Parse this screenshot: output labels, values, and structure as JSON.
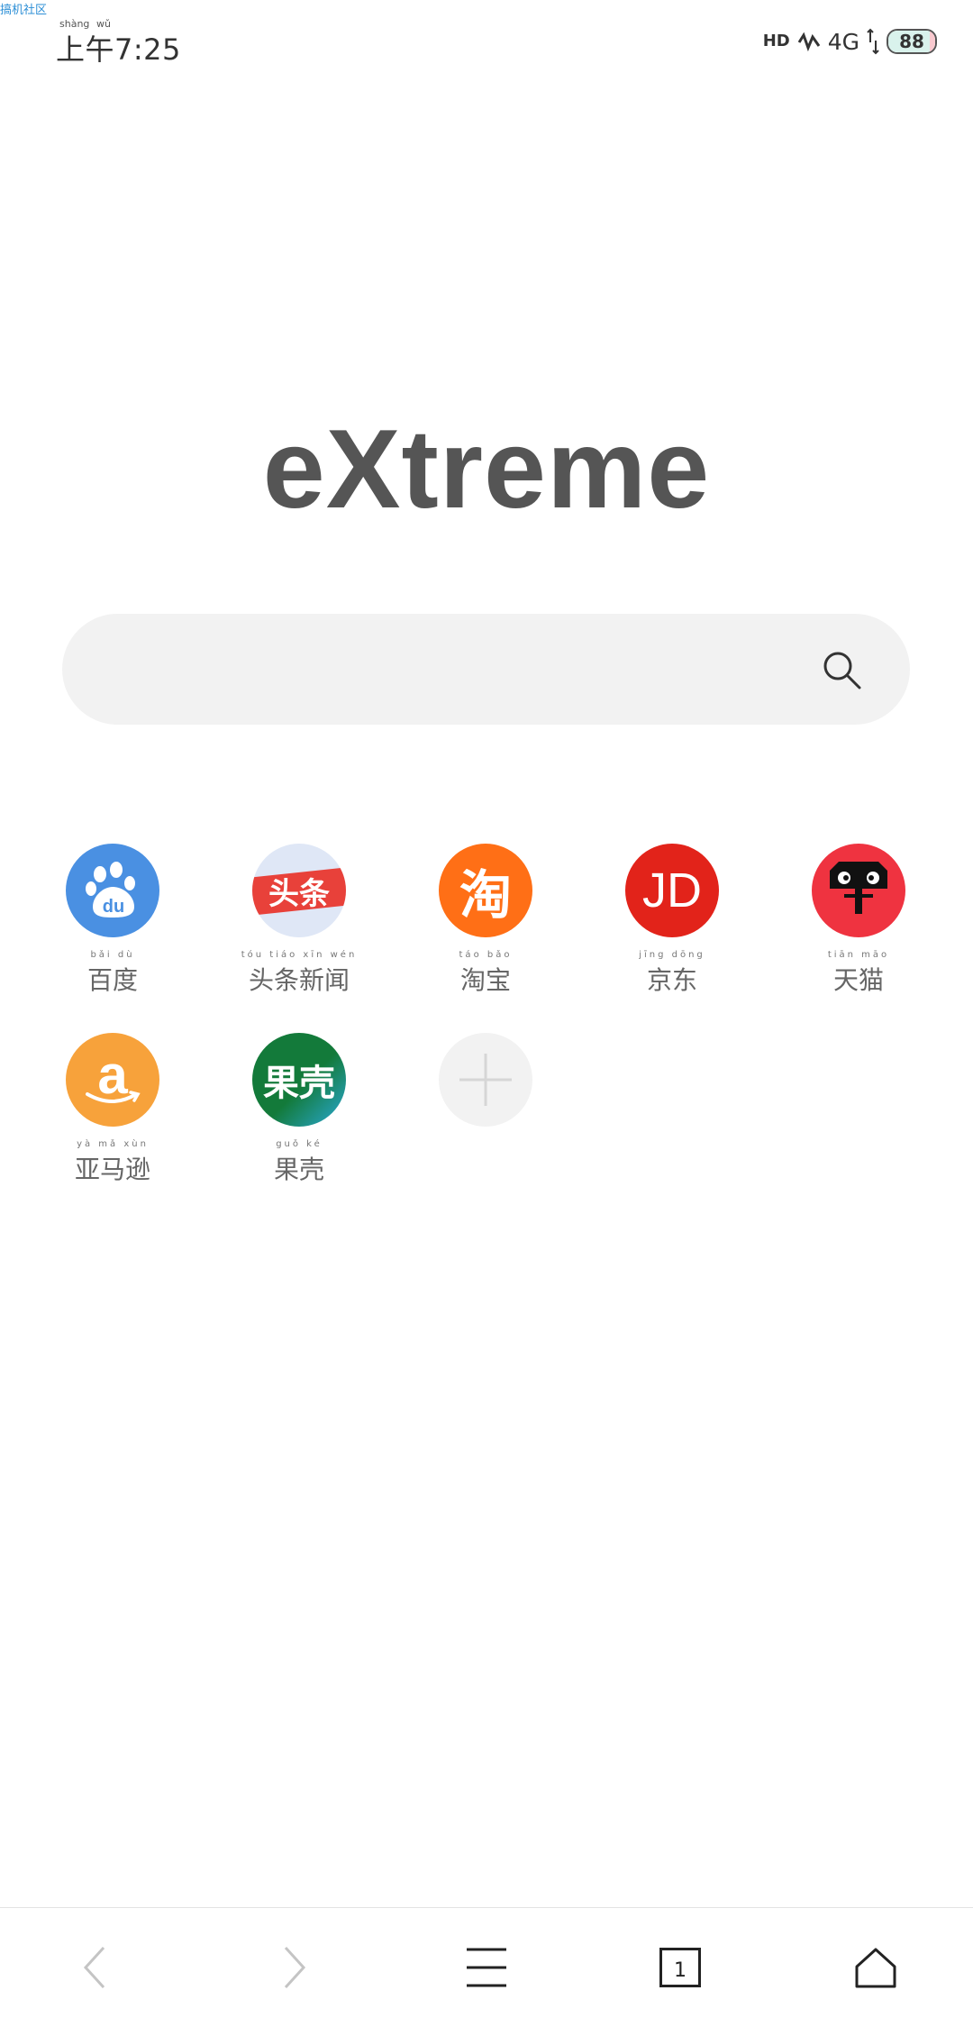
{
  "watermark": "搞机社区",
  "status_bar": {
    "time": "7:25",
    "time_prefix": "上午",
    "pinyin": [
      "shàng",
      "wǔ"
    ],
    "hd_label": "HD",
    "network": "4G",
    "battery": "88"
  },
  "logo_text": "eXtreme",
  "search": {
    "placeholder": "",
    "icon": "search-icon"
  },
  "shortcuts": [
    {
      "label": "百度",
      "pinyin": "bǎi dù",
      "color": "#4a90e2",
      "icon": "baidu-paw-icon"
    },
    {
      "label": "头条新闻",
      "pinyin": "tóu tiáo xīn wén",
      "color": "#e8413a",
      "icon": "toutiao-icon",
      "icon_text": "头条"
    },
    {
      "label": "淘宝",
      "pinyin": "táo bǎo",
      "color": "#ff6f16",
      "icon": "taobao-icon",
      "icon_text": "淘"
    },
    {
      "label": "京东",
      "pinyin": "jīng dōng",
      "color": "#e2231a",
      "icon": "jd-icon",
      "icon_text": "JD"
    },
    {
      "label": "天猫",
      "pinyin": "tiān māo",
      "color": "#ef3340",
      "icon": "tmall-cat-icon"
    },
    {
      "label": "亚马逊",
      "pinyin": "yà mǎ xùn",
      "color": "#f7a23b",
      "icon": "amazon-icon",
      "icon_text": "a"
    },
    {
      "label": "果壳",
      "pinyin": "guǒ ké",
      "color": "#137a3a",
      "icon": "guokr-icon",
      "icon_text": "果壳"
    }
  ],
  "add_shortcut": {
    "icon": "plus-icon"
  },
  "bottom_nav": {
    "tab_count": "1",
    "icons": [
      "back-arrow-icon",
      "forward-arrow-icon",
      "menu-icon",
      "tabs-icon",
      "home-icon"
    ]
  }
}
